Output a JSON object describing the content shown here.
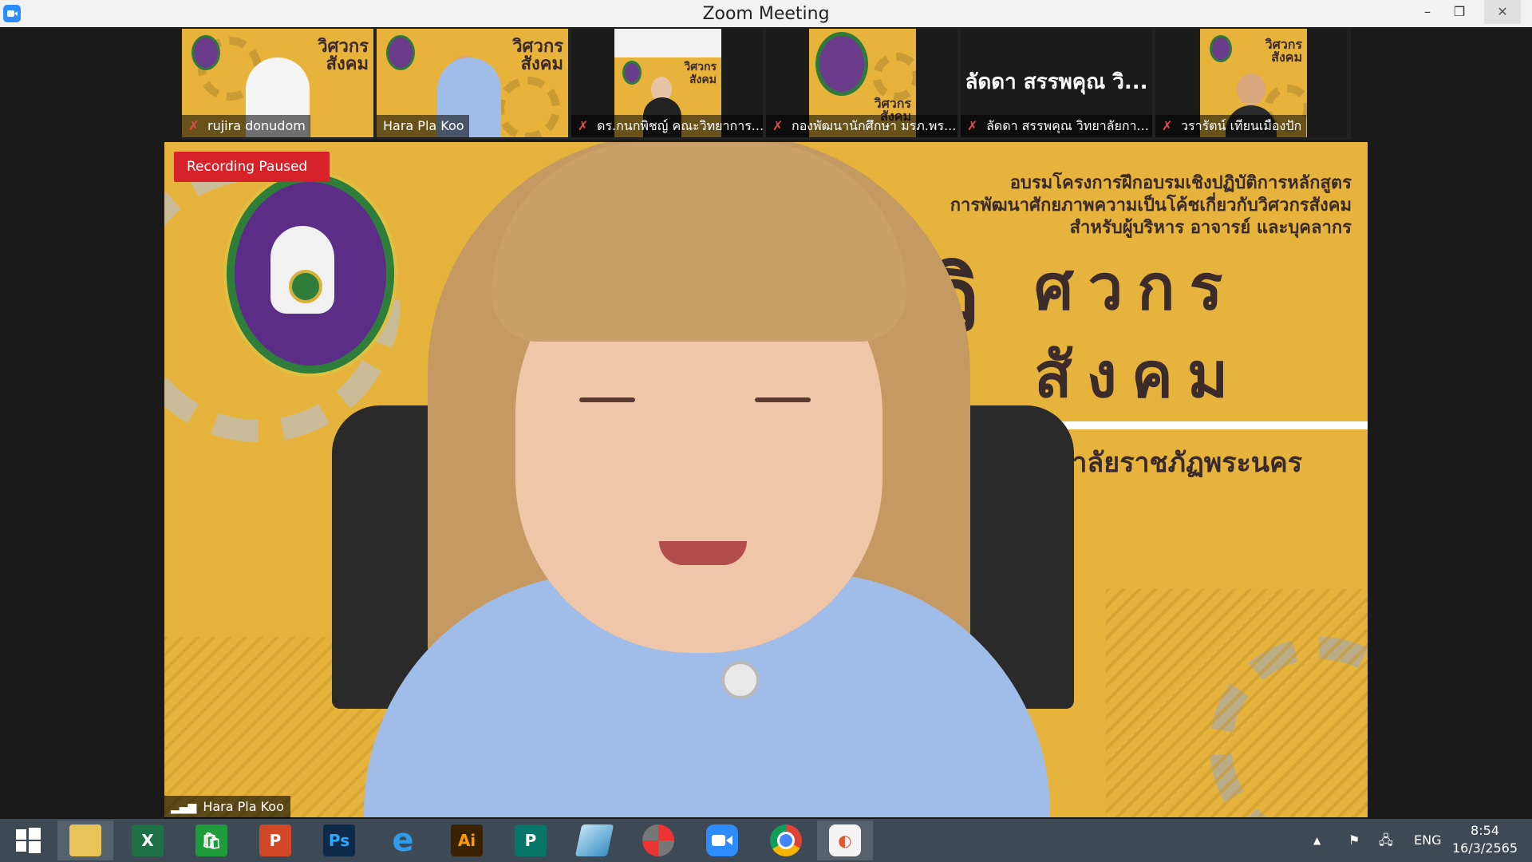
{
  "window": {
    "title": "Zoom Meeting",
    "minimize": "–",
    "restore": "❐",
    "close": "✕"
  },
  "participants": [
    {
      "name": "rujira donudom",
      "muted": true,
      "video": true
    },
    {
      "name": "Hara Pla Koo",
      "muted": false,
      "video": true,
      "active": true
    },
    {
      "name": "ดร.กนกพิชญ์ คณะวิทยาการ...",
      "muted": true,
      "video": true
    },
    {
      "name": "กองพัฒนานักศึกษา มรภ.พร...",
      "muted": true,
      "video": true
    },
    {
      "name": "ลัดดา สรรพคุณ วิทยาลัยกา...",
      "muted": true,
      "video": false,
      "display_name": "ลัดดา สรรพคุณ วิ..."
    },
    {
      "name": "วรารัตน์ เทียนเมืองปัก",
      "muted": true,
      "video": true
    }
  ],
  "tile_text": {
    "banner_short": "วิศวกร สังคม"
  },
  "main_video": {
    "recording_status": "Recording Paused",
    "speaker_name": "Hara Pla Koo",
    "banner_line1": "อบรมโครงการฝึกอบรมเชิงปฏิบัติการหลักสูตร",
    "banner_line2": "การพัฒนาศักยภาพความเป็นโค้ชเกี่ยวกับวิศวกรสังคม",
    "banner_line3": "สำหรับผู้บริหาร อาจารย์ และบุคลากร",
    "banner_big_vi": "วิ",
    "banner_big_1": "ศวกร",
    "banner_big_2": "สังคม",
    "banner_university": "มหาวิทยาลัยราชภัฏพระนคร"
  },
  "taskbar": {
    "apps": [
      {
        "icon": "windows-start-icon",
        "label": ""
      },
      {
        "icon": "file-explorer-icon",
        "label": ""
      },
      {
        "icon": "excel-icon",
        "label": "X"
      },
      {
        "icon": "store-icon",
        "label": "🛍"
      },
      {
        "icon": "powerpoint-icon",
        "label": "P"
      },
      {
        "icon": "photoshop-icon",
        "label": "Ps"
      },
      {
        "icon": "internet-explorer-icon",
        "label": "e"
      },
      {
        "icon": "illustrator-icon",
        "label": "Ai"
      },
      {
        "icon": "publisher-icon",
        "label": "P"
      },
      {
        "icon": "app-icon",
        "label": ""
      },
      {
        "icon": "photoscape-icon",
        "label": ""
      },
      {
        "icon": "zoom-icon",
        "label": ""
      },
      {
        "icon": "chrome-icon",
        "label": ""
      },
      {
        "icon": "slides-icon",
        "label": ""
      }
    ],
    "tray_arrow": "▲",
    "language": "ENG",
    "time": "8:54",
    "date": "16/3/2565"
  },
  "colors": {
    "accent_yellow": "#e6b43c",
    "recording_red": "#d6232a",
    "taskbar": "#3d4a56"
  }
}
